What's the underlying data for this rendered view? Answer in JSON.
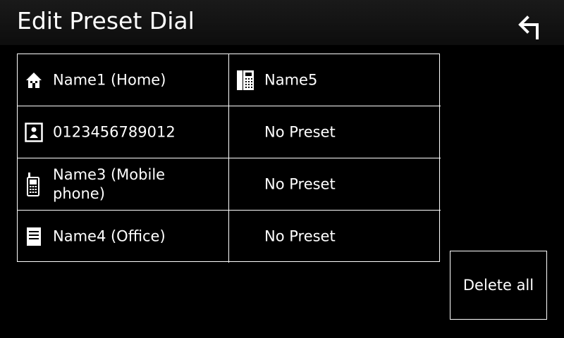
{
  "header": {
    "title": "Edit Preset Dial",
    "back_icon": "return-arrow-icon"
  },
  "presets": [
    {
      "label": "Name1 (Home)",
      "icon": "home-icon"
    },
    {
      "label": "Name5",
      "icon": "general-phone-icon"
    },
    {
      "label": "0123456789012",
      "icon": "contact-icon"
    },
    {
      "label": "No Preset",
      "icon": ""
    },
    {
      "label": "Name3 (Mobile phone)",
      "icon": "mobile-phone-icon"
    },
    {
      "label": "No Preset",
      "icon": ""
    },
    {
      "label": "Name4 (Office)",
      "icon": "office-icon"
    },
    {
      "label": "No Preset",
      "icon": ""
    }
  ],
  "actions": {
    "delete_all_label": "Delete all"
  },
  "colors": {
    "background": "#000000",
    "header": "#141414",
    "text": "#ffffff",
    "border": "#ffffff"
  }
}
